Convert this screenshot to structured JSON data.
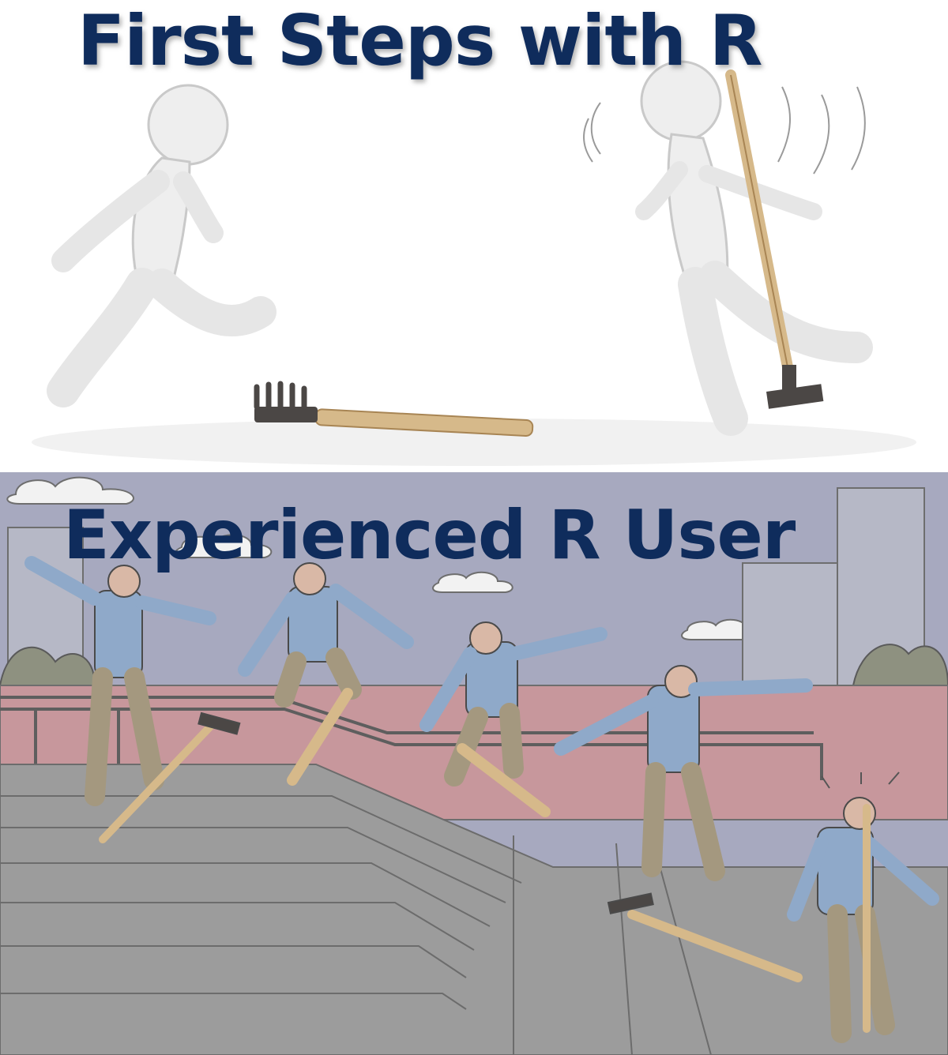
{
  "meme": {
    "top_caption": "First Steps with R",
    "bottom_caption": "Experienced R User"
  },
  "colors": {
    "caption_text": "#0f2c5c",
    "sky": "#a7a9bf",
    "wall": "#c7979c",
    "stairs": "#9c9c9c",
    "shirt": "#8fa9c9",
    "pants": "#a4987f",
    "rake_handle": "#d6b98a"
  },
  "icons": [
    "rake-icon",
    "broom-icon",
    "stick-figure",
    "skater-figure"
  ]
}
